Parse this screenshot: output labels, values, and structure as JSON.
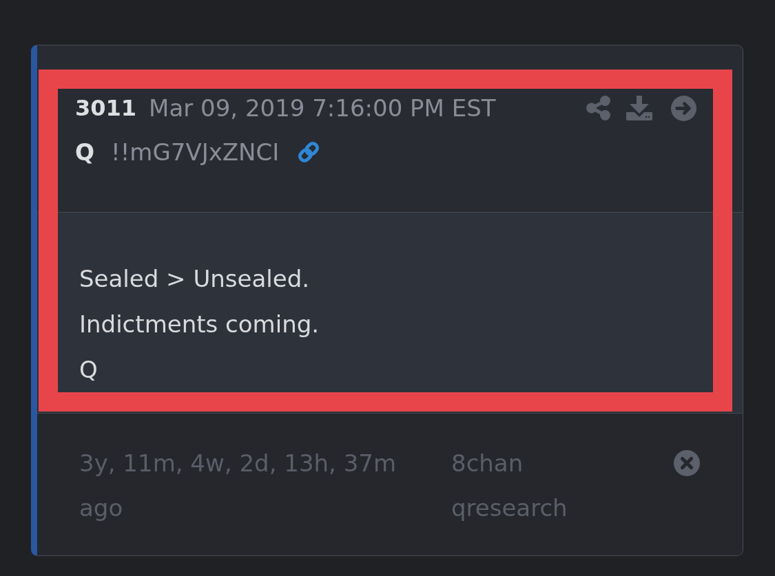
{
  "post": {
    "number": "3011",
    "timestamp": "Mar 09, 2019 7:16:00 PM EST",
    "author": "Q",
    "tripcode": "!!mG7VJxZNCI",
    "highlighted": true,
    "body_lines": [
      "Sealed > Unsealed.",
      "Indictments coming.",
      "Q"
    ]
  },
  "footer": {
    "elapsed": "3y, 11m, 4w, 2d, 13h, 37m ago",
    "site": "8chan",
    "board": "qresearch"
  }
}
